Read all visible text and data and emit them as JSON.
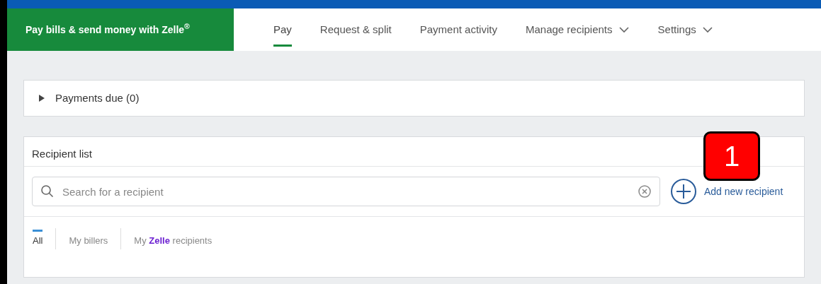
{
  "brand": {
    "title": "Pay bills & send money with Zelle$^{®}$"
  },
  "nav": [
    {
      "label": "Pay",
      "selected": true,
      "dropdown": false
    },
    {
      "label": "Request & split",
      "selected": false,
      "dropdown": false
    },
    {
      "label": "Payment activity",
      "selected": false,
      "dropdown": false
    },
    {
      "label": "Manage recipients",
      "selected": false,
      "dropdown": true
    },
    {
      "label": "Settings",
      "selected": false,
      "dropdown": true
    }
  ],
  "payments_due": {
    "label": "Payments due (0)",
    "expanded": false
  },
  "recipient_list": {
    "title": "Recipient list",
    "search": {
      "placeholder": "Search for a recipient"
    },
    "add_button": "Add new recipient",
    "filters": [
      {
        "parts": [
          "All"
        ],
        "selected": true
      },
      {
        "parts": [
          "My billers"
        ],
        "selected": false
      },
      {
        "parts": [
          "My",
          "Zelle",
          "recipients"
        ],
        "selected": false
      }
    ]
  },
  "callout": {
    "label": "1"
  }
}
